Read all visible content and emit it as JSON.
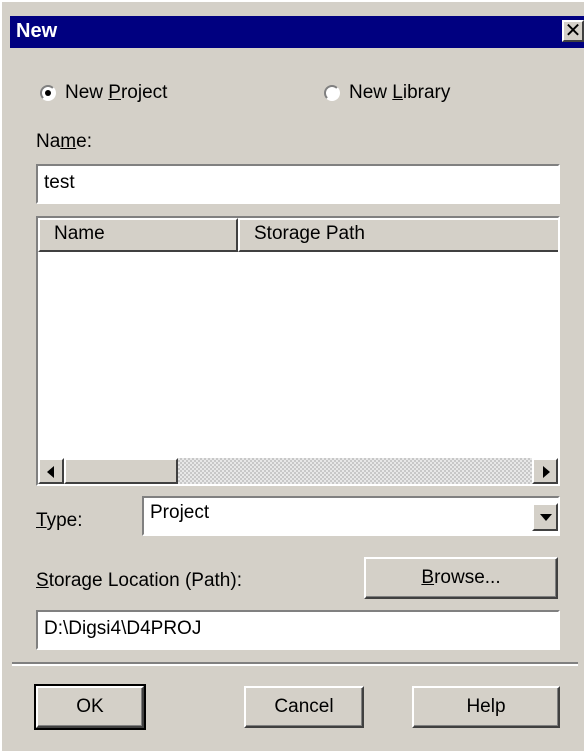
{
  "window": {
    "title": "New",
    "close_glyph": "✕"
  },
  "radios": [
    {
      "pre": "New ",
      "mnemonic": "P",
      "post": "roject",
      "checked": true
    },
    {
      "pre": "New ",
      "mnemonic": "L",
      "post": "ibrary",
      "checked": false
    }
  ],
  "name_label": {
    "pre": "Na",
    "mnemonic": "m",
    "post": "e:"
  },
  "name_value": "test",
  "list": {
    "columns": [
      "Name",
      "Storage Path"
    ],
    "rows": []
  },
  "type_label": {
    "mnemonic": "T",
    "post": "ype:"
  },
  "type_value": "Project",
  "storage_label": {
    "mnemonic": "S",
    "post": "torage Location (Path):"
  },
  "browse": {
    "mnemonic": "B",
    "post": "rowse..."
  },
  "storage_value": "D:\\Digsi4\\D4PROJ",
  "buttons": {
    "ok": "OK",
    "cancel": "Cancel",
    "help": "Help"
  },
  "colors": {
    "titlebar": "#000080",
    "face": "#d4d0c8"
  }
}
